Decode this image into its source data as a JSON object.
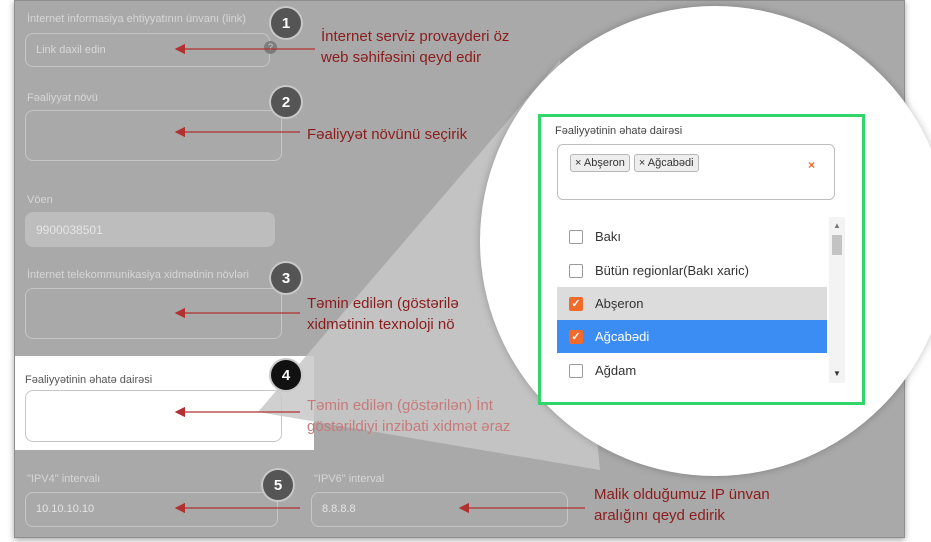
{
  "form": {
    "f1_label": "İnternet informasiya ehtiyyatının ünvanı (link)",
    "f1_placeholder": "Link daxil edin",
    "f2_label": "Fəaliyyət növü",
    "voen_label": "Vöen",
    "voen_value": "9900038501",
    "f3_label": "İnternet telekommunikasiya xidmətinin növləri",
    "f4_label": "Fəaliyyətinin əhatə dairəsi",
    "ipv4_label": "\"IPV4\" intervalı",
    "ipv4_value": "10.10.10.10",
    "ipv6_label": "\"IPV6\" interval",
    "ipv6_value": "8.8.8.8"
  },
  "badges": [
    "1",
    "2",
    "3",
    "4",
    "5"
  ],
  "notes": {
    "n1_line1": "İnternet serviz provayderi öz",
    "n1_line2": "web səhifəsini qeyd edir",
    "n2": "Fəaliyyət növünü seçirik",
    "n3_line1": "Təmin edilən (göstərilə",
    "n3_line2": "xidmətinin texnoloji nö",
    "n4_line1": "Təmin edilən (göstərilən) İnt",
    "n4_line2": "göstərildiyi inzibati xidmət əraz",
    "n5_line1": "Malik olduğumuz IP ünvan",
    "n5_line2": "aralığını qeyd edirik"
  },
  "zoom": {
    "label": "Fəaliyyətinin əhatə dairəsi",
    "tags": [
      "Abşeron",
      "Ağcabədi"
    ],
    "options": [
      {
        "label": "Bakı",
        "checked": false
      },
      {
        "label": "Bütün regionlar(Bakı xaric)",
        "checked": false
      },
      {
        "label": "Abşeron",
        "checked": true
      },
      {
        "label": "Ağcabədi",
        "checked": true
      },
      {
        "label": "Ağdam",
        "checked": false
      }
    ]
  },
  "colors": {
    "accent": "#f26a2a",
    "highlight": "#3b8cf3",
    "frame": "#32d56a",
    "note": "#8b1c1c"
  }
}
